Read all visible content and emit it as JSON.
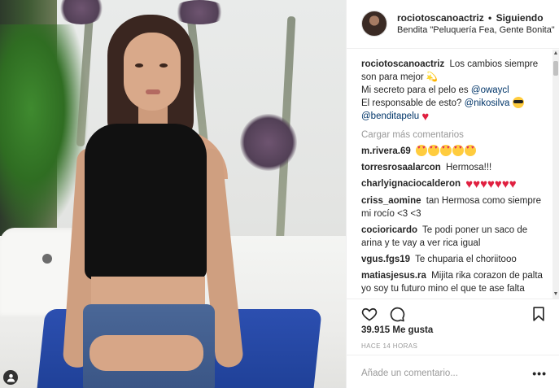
{
  "post": {
    "username": "rociotoscanoactriz",
    "separator": "•",
    "follow_label": "Siguiendo",
    "location": "Bendita \"Peluquería Fea, Gente Bonita\""
  },
  "caption": {
    "username": "rociotoscanoactriz",
    "line1": "Los cambios siempre son para mejor",
    "comet_emoji": "💫",
    "line2_text": "Mi secreto para el pelo es",
    "line2_mention": "@owaycl",
    "line3_text": "El responsable de esto?",
    "line3_mention": "@nikosilva",
    "line4_mention": "@benditapelu"
  },
  "load_more_label": "Cargar más comentarios",
  "comments": [
    {
      "username": "m.rivera.69",
      "text": ""
    },
    {
      "username": "torresrosaalarcon",
      "text": "Hermosa!!!"
    },
    {
      "username": "charlyignaciocalderon",
      "text": ""
    },
    {
      "username": "criss_aomine",
      "text": "tan Hermosa como siempre mi rocío <3 <3"
    },
    {
      "username": "cocioricardo",
      "text": "Te podi poner un saco de arina y te vay a ver rica igual"
    },
    {
      "username": "vgus.fgs19",
      "text": "Te chuparia el choriitooo"
    },
    {
      "username": "matiasjesus.ra",
      "text": "Mijita rika corazon de palta yo soy tu futuro mino el que te ase falta"
    }
  ],
  "likes_label": "39.915 Me gusta",
  "time_label": "HACE 14 HORAS",
  "add_comment_placeholder": "Añade un comentario...",
  "more_options_label": "•••",
  "icons": {
    "like": "heart-outline-icon",
    "comment": "speech-bubble-icon",
    "save": "bookmark-icon",
    "tag": "person-tag-icon"
  },
  "colors": {
    "mention": "#003569",
    "muted": "#999999",
    "heart": "#e02040",
    "cushion": "#1e3f95"
  }
}
